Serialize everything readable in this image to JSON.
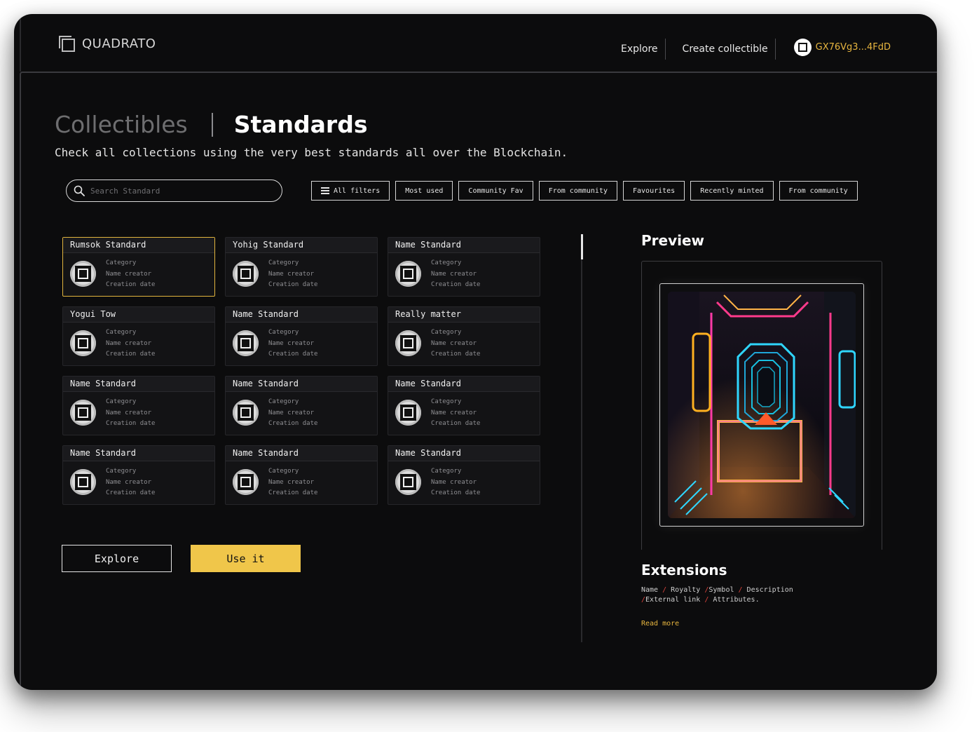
{
  "header": {
    "logo_text": "QUADRATO",
    "nav": [
      {
        "label": "Explore"
      },
      {
        "label": "Create collectible"
      }
    ],
    "wallet_address": "GX76Vg3...4FdD"
  },
  "page": {
    "tabs": [
      {
        "label": "Collectibles",
        "active": false
      },
      {
        "label": "Standards",
        "active": true
      }
    ],
    "subtitle": "Check all collections using the very best standards all over the Blockchain."
  },
  "search": {
    "placeholder": "Search Standard",
    "value": ""
  },
  "filters": [
    {
      "label": "All filters",
      "icon": "sliders-icon"
    },
    {
      "label": "Most used"
    },
    {
      "label": "Community Fav"
    },
    {
      "label": "From community"
    },
    {
      "label": "Favourites"
    },
    {
      "label": "Recently minted"
    },
    {
      "label": "From community"
    }
  ],
  "cards": [
    {
      "title": "Rumsok Standard",
      "category": "Category",
      "creator": "Name creator",
      "date": "Creation date",
      "selected": true
    },
    {
      "title": "Yohig Standard",
      "category": "Category",
      "creator": "Name creator",
      "date": "Creation date"
    },
    {
      "title": "Name Standard",
      "category": "Category",
      "creator": "Name creator",
      "date": "Creation date"
    },
    {
      "title": "Yogui Tow",
      "category": "Category",
      "creator": "Name creator",
      "date": "Creation date"
    },
    {
      "title": "Name Standard",
      "category": "Category",
      "creator": "Name creator",
      "date": "Creation date"
    },
    {
      "title": "Really matter",
      "category": "Category",
      "creator": "Name creator",
      "date": "Creation date"
    },
    {
      "title": "Name Standard",
      "category": "Category",
      "creator": "Name creator",
      "date": "Creation date"
    },
    {
      "title": "Name Standard",
      "category": "Category",
      "creator": "Name creator",
      "date": "Creation date"
    },
    {
      "title": "Name Standard",
      "category": "Category",
      "creator": "Name creator",
      "date": "Creation date"
    },
    {
      "title": "Name Standard",
      "category": "Category",
      "creator": "Name creator",
      "date": "Creation date"
    },
    {
      "title": "Name Standard",
      "category": "Category",
      "creator": "Name creator",
      "date": "Creation date"
    },
    {
      "title": "Name Standard",
      "category": "Category",
      "creator": "Name creator",
      "date": "Creation date"
    }
  ],
  "actions": {
    "explore_label": "Explore",
    "use_label": "Use it"
  },
  "preview": {
    "title": "Preview",
    "image_icon": "neon-corridor-artwork"
  },
  "extensions": {
    "title": "Extensions",
    "items": [
      "Name",
      "Royalty",
      "Symbol",
      "Description",
      "External link",
      "Attributes."
    ],
    "read_more": "Read more"
  },
  "colors": {
    "accent": "#f0c64a",
    "wallet": "#e8b63f",
    "separator": "#d9433b",
    "background": "#0c0c0d"
  }
}
